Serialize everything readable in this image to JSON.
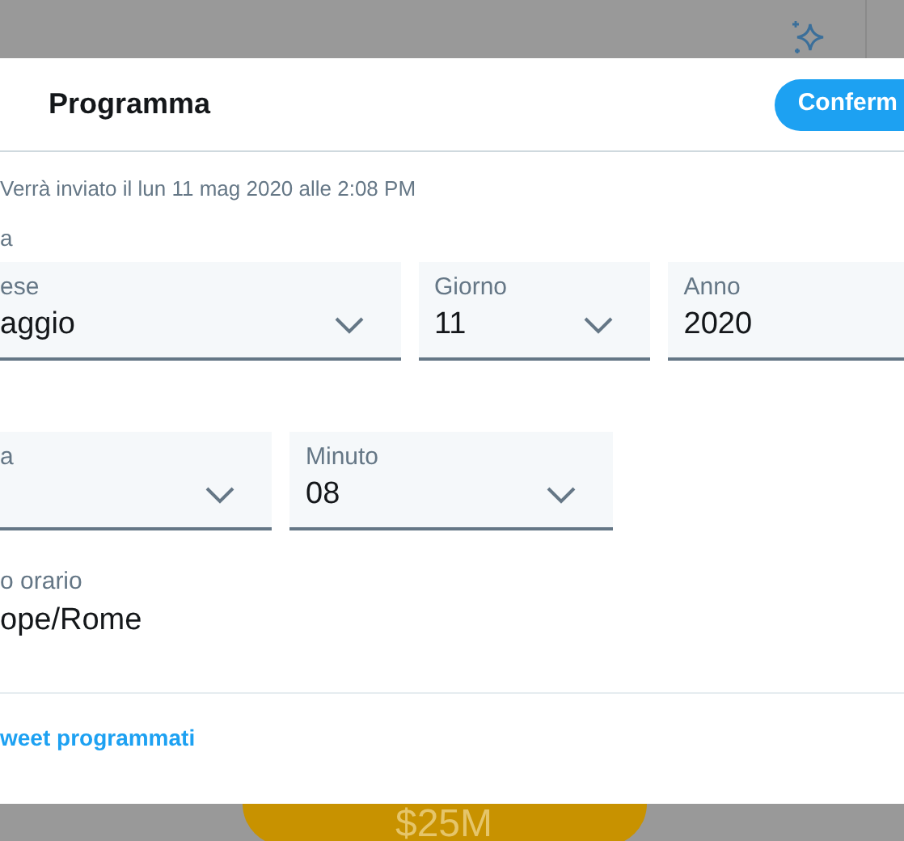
{
  "dialog": {
    "title": "Programma",
    "confirm_button": "Conferm",
    "summary": "Verrà inviato il lun 11 mag 2020 alle 2:08 PM",
    "sections": [
      {
        "label": "a",
        "fields": [
          {
            "label": "ese",
            "value": "aggio",
            "dropdown": true
          },
          {
            "label": "Giorno",
            "value": "11",
            "dropdown": true
          },
          {
            "label": "Anno",
            "value": "2020",
            "dropdown": false
          }
        ]
      },
      {
        "fields": [
          {
            "label": "a",
            "dropdown": true
          },
          {
            "label": "Minuto",
            "value": "08",
            "dropdown": true
          }
        ]
      }
    ],
    "timezone": {
      "label": "o orario",
      "value": "ope/Rome"
    },
    "footer_link": "weet programmati"
  },
  "background": {
    "amount": "$25M"
  }
}
